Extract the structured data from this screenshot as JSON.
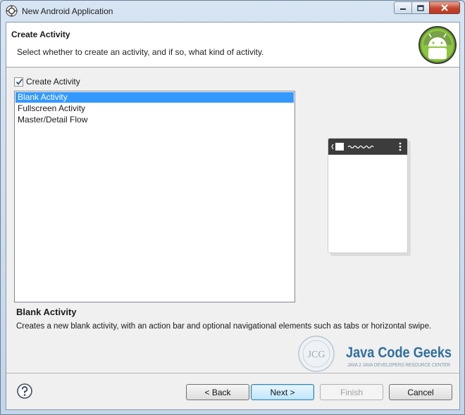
{
  "window": {
    "title": "New Android Application",
    "controls": [
      "minimize-icon",
      "maximize-icon",
      "close-icon"
    ]
  },
  "banner": {
    "title": "Create Activity",
    "description": "Select whether to create an activity, and if so, what kind of activity.",
    "logo_icon": "android-logo"
  },
  "create_activity": {
    "label": "Create Activity",
    "checked": true
  },
  "activity_list": {
    "items": [
      "Blank Activity",
      "Fullscreen Activity",
      "Master/Detail Flow"
    ],
    "selected": "Blank Activity"
  },
  "detail": {
    "title": "Blank Activity",
    "text": "Creates a new blank activity, with an action bar and optional navigational elements such as tabs or horizontal swipe."
  },
  "watermark": {
    "monogram": "JCG",
    "name": "Java Code Geeks",
    "tagline": "JAVA 2 JAVA DEVELOPERS RESOURCE CENTER"
  },
  "buttons": {
    "back": "< Back",
    "next": "Next >",
    "finish": "Finish",
    "cancel": "Cancel"
  },
  "colors": {
    "selection": "#3399ff",
    "android_green": "#8dc63f",
    "watermark_blue": "#2f6f9f"
  }
}
